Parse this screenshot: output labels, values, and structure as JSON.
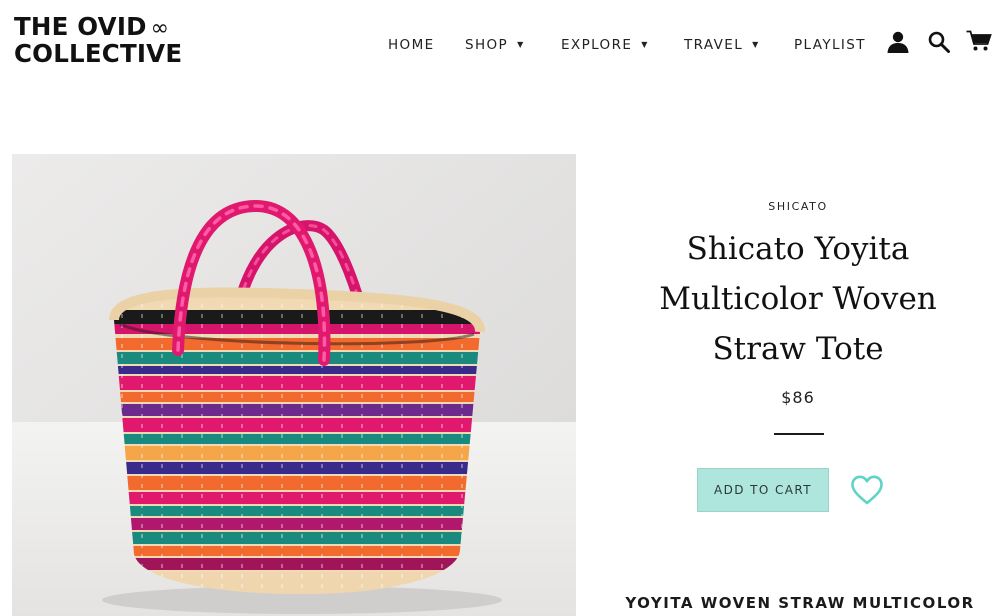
{
  "header": {
    "logo_line1": "THE OVID",
    "logo_symbol": "∞",
    "logo_line2": "COLLECTIVE",
    "nav": [
      {
        "label": "HOME",
        "has_dropdown": false
      },
      {
        "label": "SHOP",
        "has_dropdown": true
      },
      {
        "label": "EXPLORE",
        "has_dropdown": true
      },
      {
        "label": "TRAVEL",
        "has_dropdown": true
      },
      {
        "label": "PLAYLIST",
        "has_dropdown": false
      }
    ],
    "icons": [
      "account-icon",
      "search-icon",
      "cart-icon"
    ],
    "caret": "▼"
  },
  "product": {
    "image_icon": "woven-straw-tote-photo",
    "vendor": "SHICATO",
    "title": "Shicato Yoyita Multicolor Woven Straw Tote",
    "price": "$86",
    "add_to_cart_label": "ADD TO CART",
    "wishlist_icon": "heart-icon",
    "description_heading": "YOYITA WOVEN STRAW MULTICOLOR"
  },
  "colors": {
    "accent_button": "#aee5dc",
    "wishlist_heart": "#5fd3c4",
    "text": "#1a1a1a",
    "basket_pink": "#e0186e",
    "basket_teal": "#1a8a7e",
    "basket_orange": "#f26a2e",
    "basket_purple": "#3a2a8c"
  }
}
